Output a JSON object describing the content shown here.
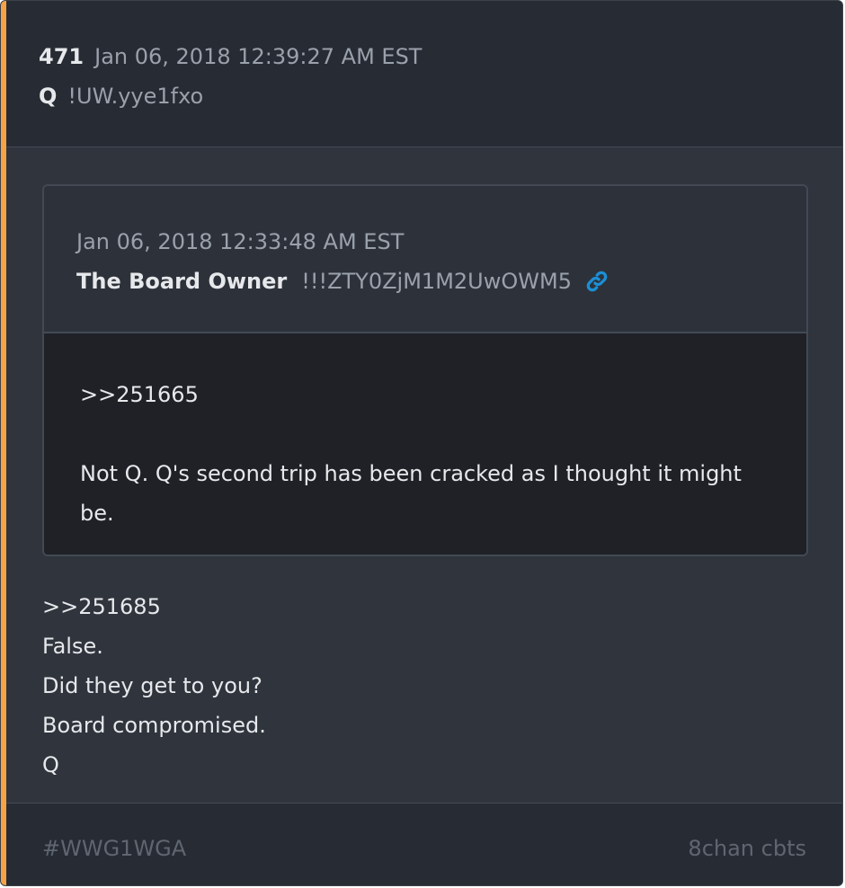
{
  "post": {
    "number": "471",
    "timestamp": "Jan 06, 2018 12:39:27 AM EST",
    "author": "Q",
    "tripcode": "!UW.yye1fxo"
  },
  "quoted_post": {
    "timestamp": "Jan 06, 2018 12:33:48 AM EST",
    "author": "The Board Owner",
    "tripcode": "!!!ZTY0ZjM1M2UwOWM5",
    "link_icon": "link-icon",
    "body_lines": [
      ">>251665",
      "Not Q. Q's second trip has been cracked as I thought it might be."
    ]
  },
  "body_lines": [
    ">>251685",
    "False.",
    "Did they get to you?",
    "Board compromised.",
    "Q"
  ],
  "footer": {
    "tag": "#WWG1WGA",
    "source": "8chan cbts"
  },
  "colors": {
    "accent": "#f6a245",
    "link": "#1b8fd6",
    "card_bg": "#2f343d",
    "header_bg": "#272b33",
    "quote_body_bg": "#1f2127"
  }
}
